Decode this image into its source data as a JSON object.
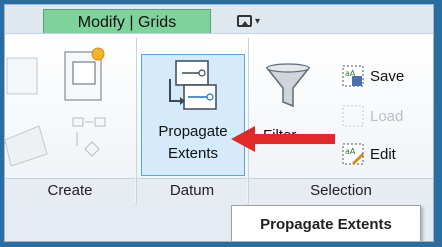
{
  "tab": {
    "label": "Modify | Grids"
  },
  "buttons": {
    "propagate_line1": "Propagate",
    "propagate_line2": "Extents",
    "filter": "Filter",
    "save": "Save",
    "load": "Load",
    "edit": "Edit"
  },
  "panels": {
    "create": "Create",
    "datum": "Datum",
    "selection": "Selection"
  },
  "tooltip": {
    "text": "Propagate Extents"
  },
  "colors": {
    "tab_green": "#7ed39c",
    "highlight": "#d5ebfb",
    "arrow_red": "#e02a2a"
  },
  "icons": [
    "propagate-extents-icon",
    "filter-funnel-icon",
    "save-selection-icon",
    "load-selection-icon",
    "edit-selection-icon",
    "red-pointer-arrow"
  ]
}
